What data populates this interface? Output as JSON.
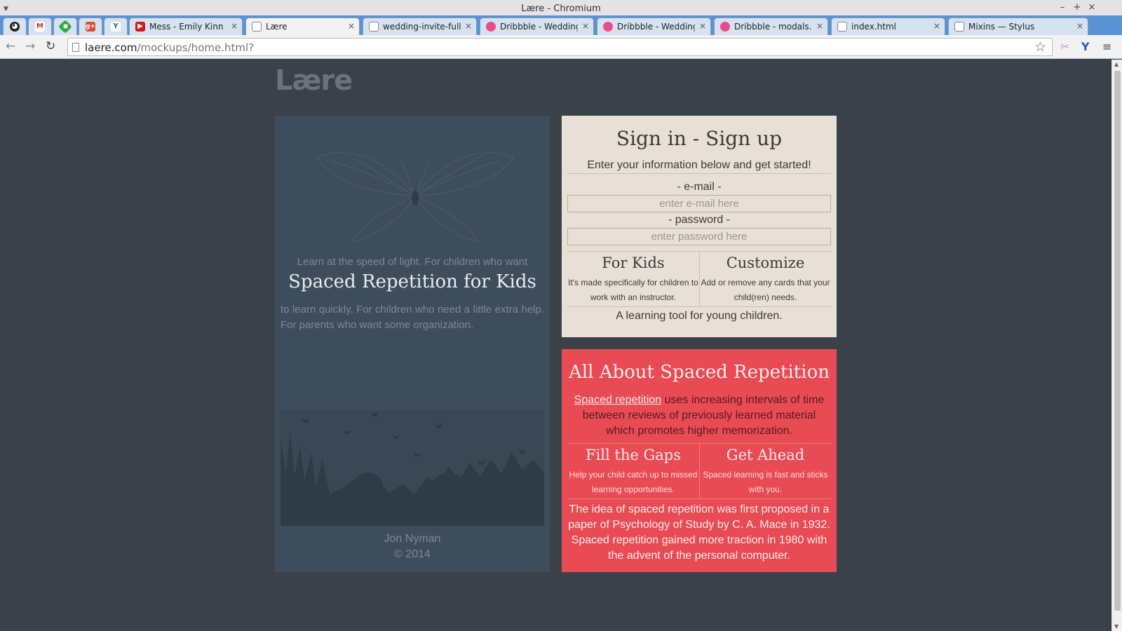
{
  "window": {
    "title": "Lære - Chromium",
    "controls": [
      "–",
      "+",
      "×"
    ]
  },
  "tabs": [
    {
      "label": "",
      "icon": "alien-icon",
      "color": "#ffffff"
    },
    {
      "label": "",
      "icon": "gmail-icon",
      "color": "#d93025"
    },
    {
      "label": "",
      "icon": "green-diamond-icon",
      "color": "#2eaa4b"
    },
    {
      "label": "",
      "icon": "google-plus-icon",
      "color": "#dd4b39"
    },
    {
      "label": "",
      "icon": "y-icon",
      "color": "#1a5fc4"
    },
    {
      "label": "Mess - Emily Kinn",
      "icon": "youtube-icon",
      "color": "#cc181e",
      "close": "×"
    },
    {
      "label": "Lære",
      "icon": "page-icon",
      "color": "#888888",
      "close": "×",
      "active": true
    },
    {
      "label": "wedding-invite-full.",
      "icon": "page-icon",
      "color": "#888888",
      "close": "×"
    },
    {
      "label": "Dribbble - Wedding",
      "icon": "dribbble-icon",
      "color": "#ea4c89",
      "close": "×"
    },
    {
      "label": "Dribbble - Wedding",
      "icon": "dribbble-icon",
      "color": "#ea4c89",
      "close": "×"
    },
    {
      "label": "Dribbble - modals.p",
      "icon": "dribbble-icon",
      "color": "#ea4c89",
      "close": "×"
    },
    {
      "label": "index.html",
      "icon": "page-icon",
      "color": "#888888",
      "close": "×"
    },
    {
      "label": "Mixins — Stylus",
      "icon": "page-icon",
      "color": "#888888",
      "close": "×"
    }
  ],
  "address_bar": {
    "host": "laere.com",
    "path": "/mockups/home.html?"
  },
  "site": {
    "logo": "Lære",
    "tagline_top": "Learn at the speed of light. For children who want",
    "hero_title": "Spaced Repetition for Kids",
    "tagline_bottom": "to learn quickly. For children who need a little extra help. For parents who want some organization.",
    "credit_name": "Jon Nyman",
    "credit_year": "© 2014"
  },
  "signin": {
    "title": "Sign in - Sign up",
    "intro": "Enter your information below and get started!",
    "email_label": "- e-mail -",
    "email_placeholder": "enter e-mail here",
    "password_label": "- password -",
    "password_placeholder": "enter password here",
    "features": [
      {
        "title": "For Kids",
        "text": "It's made specifically for children to work with an instructor."
      },
      {
        "title": "Customize",
        "text": "Add or remove any cards that your child(ren) needs."
      }
    ],
    "footer": "A learning tool for young children."
  },
  "about": {
    "title": "All About Spaced Repetition",
    "link_text": "Spaced repetition",
    "desc_rest": " uses increasing intervals of time between reviews of previously learned material which promotes higher memorization.",
    "features": [
      {
        "title": "Fill the Gaps",
        "text": "Help your child catch up to missed learning opportunities."
      },
      {
        "title": "Get Ahead",
        "text": "Spaced learning is fast and sticks with you."
      }
    ],
    "history": "The idea of spaced repetition was first proposed in a paper of Psychology of Study by C. A. Mace in 1932. Spaced repetition gained more traction in 1980 with the advent of the personal computer."
  },
  "colors": {
    "page_bg": "#3a4149",
    "left_panel": "#3e4d5c",
    "signin_bg": "#e8e0d6",
    "about_bg": "#e84b54"
  }
}
